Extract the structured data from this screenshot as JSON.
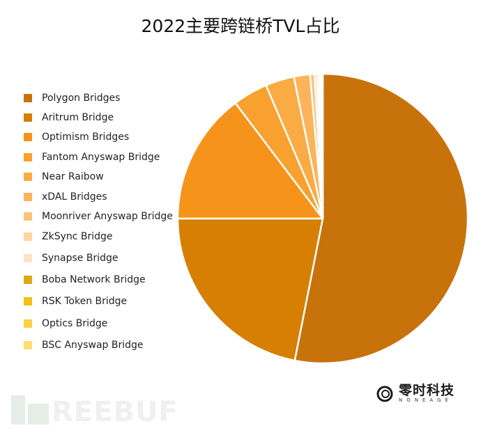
{
  "chart_data": {
    "type": "pie",
    "title": "2022主要跨链桥TVL占比",
    "legend_position": "left",
    "start_angle": "top, clockwise",
    "slices": [
      {
        "label": "Polygon Bridges",
        "value": 53.1,
        "color": "#c8720c"
      },
      {
        "label": "Aritrum Bridge",
        "value": 21.9,
        "color": "#d67f03"
      },
      {
        "label": "Optimism Bridges",
        "value": 14.7,
        "color": "#f6931a"
      },
      {
        "label": "Fantom Anyswap Bridge",
        "value": 3.9,
        "color": "#f9a12e"
      },
      {
        "label": "Near Raibow",
        "value": 3.2,
        "color": "#fbab44"
      },
      {
        "label": "xDAL Bridges",
        "value": 1.8,
        "color": "#fcb45a"
      },
      {
        "label": "Moonriver Anyswap Bridge",
        "value": 0.5,
        "color": "#fdc27a"
      },
      {
        "label": "ZkSync Bridge",
        "value": 0.3,
        "color": "#fed5a2"
      },
      {
        "label": "Synapse Bridge",
        "value": 0.25,
        "color": "#fde3c4"
      },
      {
        "label": "Boba Network Bridge",
        "value": 0.15,
        "color": "#dcaa16"
      },
      {
        "label": "RSK Token Bridge",
        "value": 0.1,
        "color": "#f6c019"
      },
      {
        "label": "Optics Bridge",
        "value": 0.05,
        "color": "#fbd043"
      },
      {
        "label": "BSC Anyswap Bridge",
        "value": 0.05,
        "color": "#fddd74"
      }
    ]
  },
  "branding": {
    "logo_cn": "零时科技",
    "logo_en": "NONEAGE",
    "watermark": "REEBUF"
  }
}
